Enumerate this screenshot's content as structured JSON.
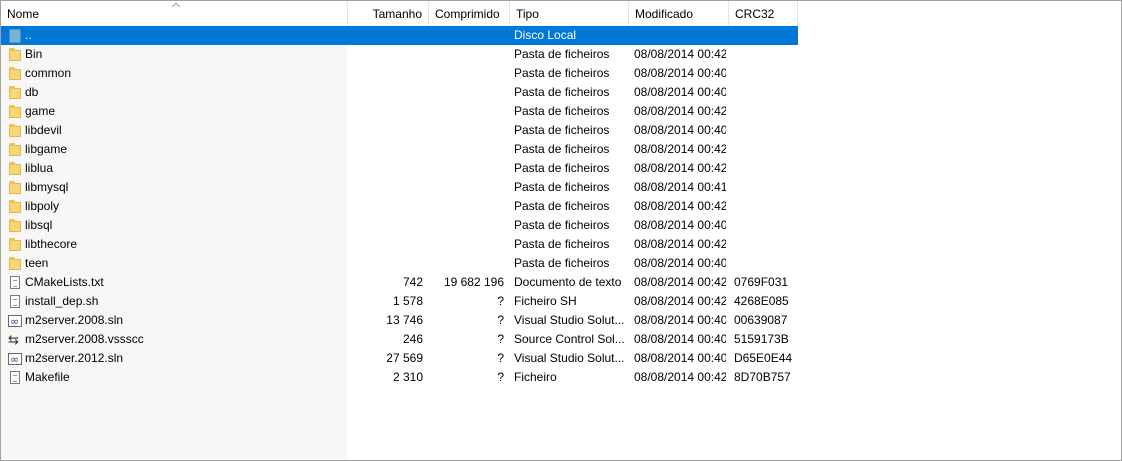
{
  "columns": {
    "name": "Nome",
    "size": "Tamanho",
    "compressed": "Comprimido",
    "type": "Tipo",
    "modified": "Modificado",
    "crc": "CRC32"
  },
  "rows": [
    {
      "icon": "parent-folder-icon",
      "name": "..",
      "size": "",
      "compressed": "",
      "type": "Disco Local",
      "modified": "",
      "crc": ""
    },
    {
      "icon": "folder-icon",
      "name": "Bin",
      "size": "",
      "compressed": "",
      "type": "Pasta de ficheiros",
      "modified": "08/08/2014 00:42",
      "crc": ""
    },
    {
      "icon": "folder-icon",
      "name": "common",
      "size": "",
      "compressed": "",
      "type": "Pasta de ficheiros",
      "modified": "08/08/2014 00:40",
      "crc": ""
    },
    {
      "icon": "folder-icon",
      "name": "db",
      "size": "",
      "compressed": "",
      "type": "Pasta de ficheiros",
      "modified": "08/08/2014 00:40",
      "crc": ""
    },
    {
      "icon": "folder-icon",
      "name": "game",
      "size": "",
      "compressed": "",
      "type": "Pasta de ficheiros",
      "modified": "08/08/2014 00:42",
      "crc": ""
    },
    {
      "icon": "folder-icon",
      "name": "libdevil",
      "size": "",
      "compressed": "",
      "type": "Pasta de ficheiros",
      "modified": "08/08/2014 00:40",
      "crc": ""
    },
    {
      "icon": "folder-icon",
      "name": "libgame",
      "size": "",
      "compressed": "",
      "type": "Pasta de ficheiros",
      "modified": "08/08/2014 00:42",
      "crc": ""
    },
    {
      "icon": "folder-icon",
      "name": "liblua",
      "size": "",
      "compressed": "",
      "type": "Pasta de ficheiros",
      "modified": "08/08/2014 00:42",
      "crc": ""
    },
    {
      "icon": "folder-icon",
      "name": "libmysql",
      "size": "",
      "compressed": "",
      "type": "Pasta de ficheiros",
      "modified": "08/08/2014 00:41",
      "crc": ""
    },
    {
      "icon": "folder-icon",
      "name": "libpoly",
      "size": "",
      "compressed": "",
      "type": "Pasta de ficheiros",
      "modified": "08/08/2014 00:42",
      "crc": ""
    },
    {
      "icon": "folder-icon",
      "name": "libsql",
      "size": "",
      "compressed": "",
      "type": "Pasta de ficheiros",
      "modified": "08/08/2014 00:40",
      "crc": ""
    },
    {
      "icon": "folder-icon",
      "name": "libthecore",
      "size": "",
      "compressed": "",
      "type": "Pasta de ficheiros",
      "modified": "08/08/2014 00:42",
      "crc": ""
    },
    {
      "icon": "folder-icon",
      "name": "teen",
      "size": "",
      "compressed": "",
      "type": "Pasta de ficheiros",
      "modified": "08/08/2014 00:40",
      "crc": ""
    },
    {
      "icon": "text-file-icon",
      "name": "CMakeLists.txt",
      "size": "742",
      "compressed": "19 682 196",
      "type": "Documento de texto",
      "modified": "08/08/2014 00:42",
      "crc": "0769F031"
    },
    {
      "icon": "text-file-icon",
      "name": "install_dep.sh",
      "size": "1 578",
      "compressed": "?",
      "type": "Ficheiro SH",
      "modified": "08/08/2014 00:42",
      "crc": "4268E085"
    },
    {
      "icon": "visual-studio-icon",
      "name": "m2server.2008.sln",
      "size": "13 746",
      "compressed": "?",
      "type": "Visual Studio Solut...",
      "modified": "08/08/2014 00:40",
      "crc": "00639087"
    },
    {
      "icon": "source-control-icon",
      "name": "m2server.2008.vssscc",
      "size": "246",
      "compressed": "?",
      "type": "Source Control Sol...",
      "modified": "08/08/2014 00:40",
      "crc": "5159173B"
    },
    {
      "icon": "visual-studio-icon",
      "name": "m2server.2012.sln",
      "size": "27 569",
      "compressed": "?",
      "type": "Visual Studio Solut...",
      "modified": "08/08/2014 00:40",
      "crc": "D65E0E44"
    },
    {
      "icon": "text-file-icon",
      "name": "Makefile",
      "size": "2 310",
      "compressed": "?",
      "type": "Ficheiro",
      "modified": "08/08/2014 00:42",
      "crc": "8D70B757"
    }
  ],
  "selected_row": 0,
  "colors": {
    "selection": "#0078d7",
    "name_column_bg": "#f7f7f7"
  }
}
